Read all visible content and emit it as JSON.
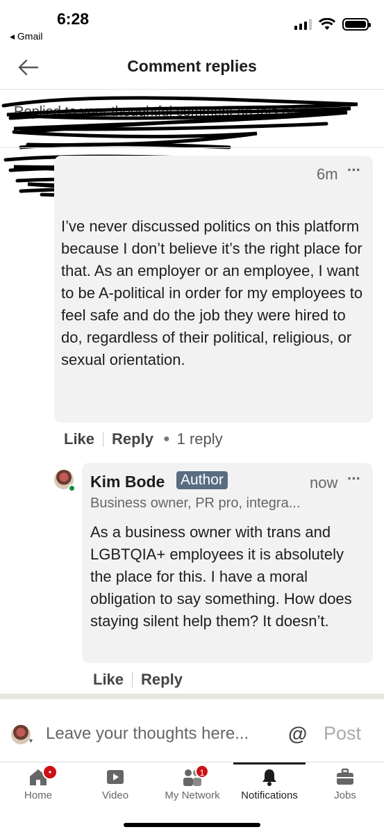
{
  "status_bar": {
    "time": "6:28",
    "back_app": "◂ Gmail"
  },
  "header": {
    "title": "Comment replies"
  },
  "redacted_note": "Replied to your thoughtful comment on this post",
  "comment": {
    "time": "6m",
    "text": "I’ve never discussed politics on this platform because I don’t believe it’s the right place for that. As an employer or an employee, I want to be A-political in order for my employees to feel safe and do the job they were hired to do, regardless of their political, religious, or sexual orientation.",
    "like_label": "Like",
    "reply_label": "Reply",
    "reply_count": "1 reply"
  },
  "reply": {
    "name": "Kim Bode",
    "badge": "Author",
    "time": "now",
    "headline": "Business owner, PR pro, integra...",
    "text": "As a business owner with trans and LGBTQIA+ employees it is absolutely the place for this. I have a moral obligation to say something. How does staying silent help them? It doesn’t.",
    "like_label": "Like",
    "reply_label": "Reply"
  },
  "compose": {
    "placeholder": "Leave your thoughts here...",
    "at_symbol": "@",
    "post_label": "Post"
  },
  "nav": {
    "items": [
      {
        "label": "Home"
      },
      {
        "label": "Video"
      },
      {
        "label": "My Network",
        "badge": "1"
      },
      {
        "label": "Notifications"
      },
      {
        "label": "Jobs"
      }
    ]
  },
  "colors": {
    "badge_red": "#cc1016",
    "author_badge": "#5a6c82",
    "online_green": "#0f8a3c"
  }
}
